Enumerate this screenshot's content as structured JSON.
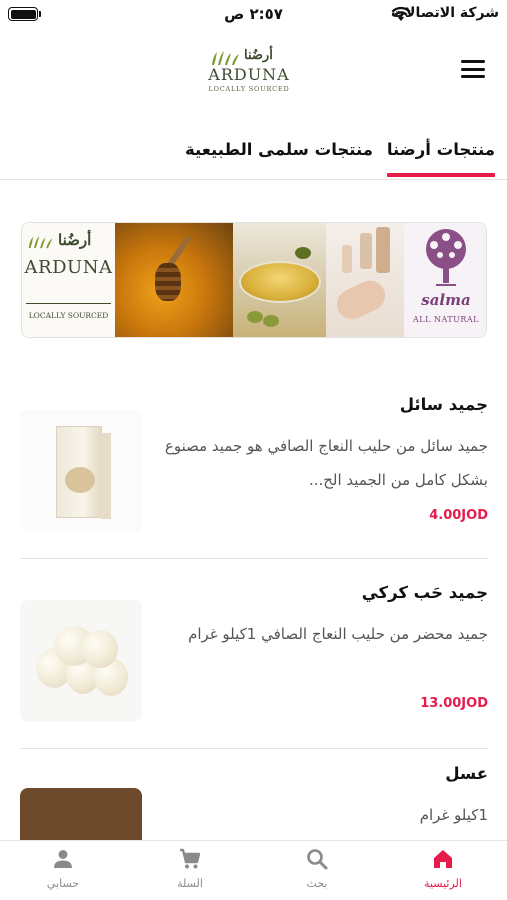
{
  "status_bar": {
    "time": "٢:٥٧ ص",
    "carrier": "شركة الاتصالات"
  },
  "header": {
    "logo": {
      "arabic": "أرضُنا",
      "name": "ARDUNA",
      "tagline": "LOCALLY SOURCED"
    },
    "menu_icon": "hamburger-menu-icon"
  },
  "tabs": [
    {
      "label": "منتجات أرضنا",
      "active": true
    },
    {
      "label": "منتجات سلمى الطبيعية",
      "active": false
    }
  ],
  "banner": {
    "arduna": {
      "arabic": "أرضُنا",
      "name": "ARDUNA",
      "tagline": "LOCALLY SOURCED"
    },
    "salma": {
      "name": "salma",
      "tagline": "ALL NATURAL"
    }
  },
  "products": [
    {
      "title": "جميد سائل",
      "description": "جميد سائل من حليب النعاج الصافي هو جميد مصنوع بشكل كامل من الجميد الح...",
      "price": "4.00JOD"
    },
    {
      "title": "جميد حَب كركي",
      "description": "جميد محضر من حليب النعاج الصافي 1كيلو غرام",
      "price": "13.00JOD"
    },
    {
      "title": "عسل",
      "description": "1كيلو غرام",
      "price": ""
    }
  ],
  "bottom_nav": [
    {
      "label": "الرئيسية",
      "icon": "home-icon",
      "active": true
    },
    {
      "label": "بحث",
      "icon": "search-icon",
      "active": false
    },
    {
      "label": "السلة",
      "icon": "cart-icon",
      "active": false
    },
    {
      "label": "حسابي",
      "icon": "account-icon",
      "active": false
    }
  ],
  "colors": {
    "accent": "#e51c4a",
    "logo_green": "#3d4a2f",
    "salma_purple": "#7a3f77"
  }
}
